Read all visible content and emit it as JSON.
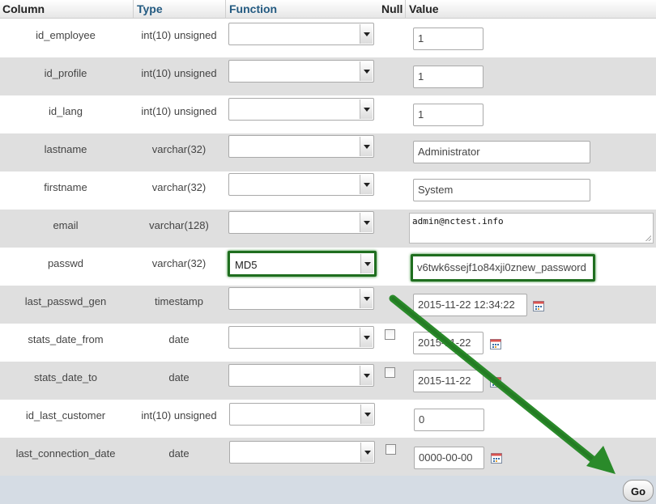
{
  "header": {
    "column": "Column",
    "type": "Type",
    "function": "Function",
    "null": "Null",
    "value": "Value"
  },
  "rows": [
    {
      "column": "id_employee",
      "type": "int(10) unsigned",
      "function": "",
      "value": "1"
    },
    {
      "column": "id_profile",
      "type": "int(10) unsigned",
      "function": "",
      "value": "1"
    },
    {
      "column": "id_lang",
      "type": "int(10) unsigned",
      "function": "",
      "value": "1"
    },
    {
      "column": "lastname",
      "type": "varchar(32)",
      "function": "",
      "value": "Administrator"
    },
    {
      "column": "firstname",
      "type": "varchar(32)",
      "function": "",
      "value": "System"
    },
    {
      "column": "email",
      "type": "varchar(128)",
      "function": "",
      "value": "admin@nctest.info"
    },
    {
      "column": "passwd",
      "type": "varchar(32)",
      "function": "MD5",
      "value": "v6twk6ssejf1o84xji0znew_password"
    },
    {
      "column": "last_passwd_gen",
      "type": "timestamp",
      "function": "",
      "value": "2015-11-22 12:34:22"
    },
    {
      "column": "stats_date_from",
      "type": "date",
      "function": "",
      "value": "2015-11-22"
    },
    {
      "column": "stats_date_to",
      "type": "date",
      "function": "",
      "value": "2015-11-22"
    },
    {
      "column": "id_last_customer",
      "type": "int(10) unsigned",
      "function": "",
      "value": "0"
    },
    {
      "column": "last_connection_date",
      "type": "date",
      "function": "",
      "value": "0000-00-00"
    }
  ],
  "footer": {
    "go_label": "Go"
  },
  "colors": {
    "highlight": "#1f6e1f",
    "arrow": "#2a8a2a",
    "header_link": "#235a81"
  }
}
